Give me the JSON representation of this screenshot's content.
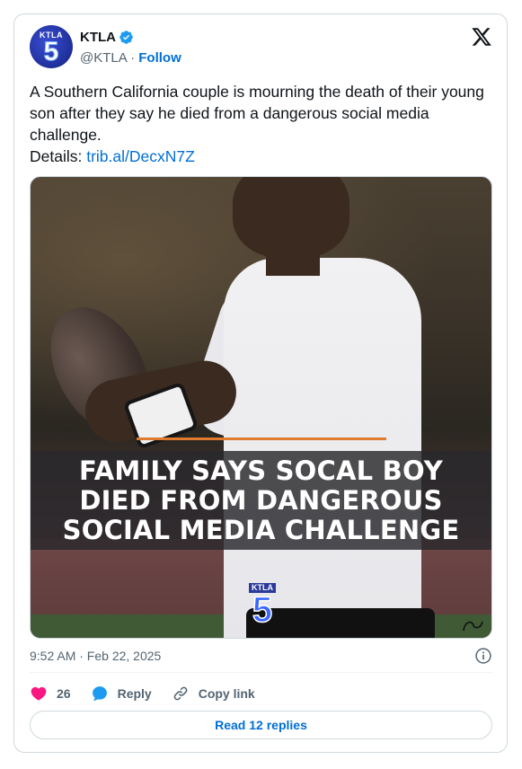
{
  "author": {
    "display_name": "KTLA",
    "handle": "@KTLA",
    "separator": " · ",
    "follow_label": "Follow",
    "avatar_text_top": "KTLA",
    "avatar_text_main": "5",
    "verified_color": "#1d9bf0"
  },
  "tweet": {
    "text": "A Southern California couple is mourning the death of their young son after they say he died from a dangerous social media challenge.",
    "details_label": "Details: ",
    "link_text": "trib.al/DecxN7Z",
    "link_color": "#006fd6"
  },
  "media": {
    "headline_lines": [
      "FAMILY SAYS SOCAL BOY",
      "DIED FROM DANGEROUS",
      "SOCIAL MEDIA CHALLENGE"
    ],
    "watermark_top": "KTLA",
    "watermark_main": "5",
    "accent_line_color": "#e07a2e"
  },
  "meta": {
    "timestamp": "9:52 AM · Feb 22, 2025"
  },
  "actions": {
    "like_count": "26",
    "reply_label": "Reply",
    "copy_link_label": "Copy link",
    "like_color": "#f91880",
    "reply_color": "#1d9bf0"
  },
  "footer": {
    "read_replies_label": "Read 12 replies"
  }
}
